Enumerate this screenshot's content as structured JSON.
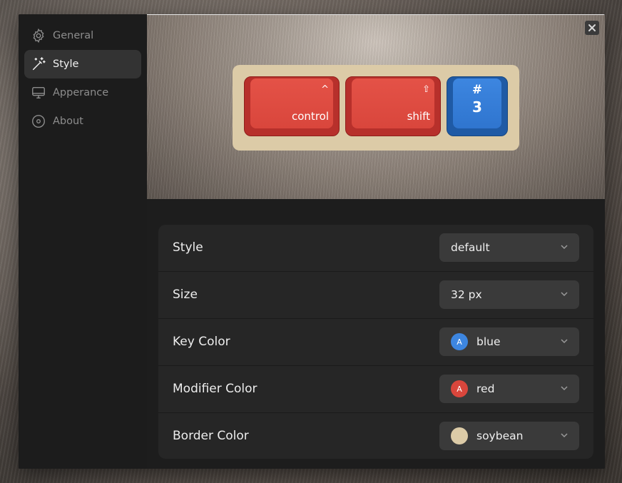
{
  "sidebar": {
    "items": [
      {
        "label": "General",
        "icon": "gear-icon",
        "active": false
      },
      {
        "label": "Style",
        "icon": "magic-wand-icon",
        "active": true
      },
      {
        "label": "Apperance",
        "icon": "monitor-icon",
        "active": false
      },
      {
        "label": "About",
        "icon": "info-circle-icon",
        "active": false
      }
    ]
  },
  "preview": {
    "keys": [
      {
        "label": "control",
        "symbol": "^",
        "color": "red"
      },
      {
        "label": "shift",
        "symbol": "⇧",
        "color": "red"
      },
      {
        "symbol": "#",
        "number": "3",
        "color": "blue"
      }
    ],
    "tray_color": "#dccba7"
  },
  "settings": {
    "rows": [
      {
        "label": "Style",
        "value": "default"
      },
      {
        "label": "Size",
        "value": "32 px"
      },
      {
        "label": "Key Color",
        "value": "blue",
        "swatch_text": "A",
        "swatch_color": "#3d86e0"
      },
      {
        "label": "Modifier Color",
        "value": "red",
        "swatch_text": "A",
        "swatch_color": "#d9463c"
      },
      {
        "label": "Border Color",
        "value": "soybean",
        "swatch_text": "",
        "swatch_color": "#dccba7"
      }
    ]
  },
  "colors": {
    "accent_red": "#d9463c",
    "accent_blue": "#2f75cf",
    "soybean": "#dccba7"
  }
}
